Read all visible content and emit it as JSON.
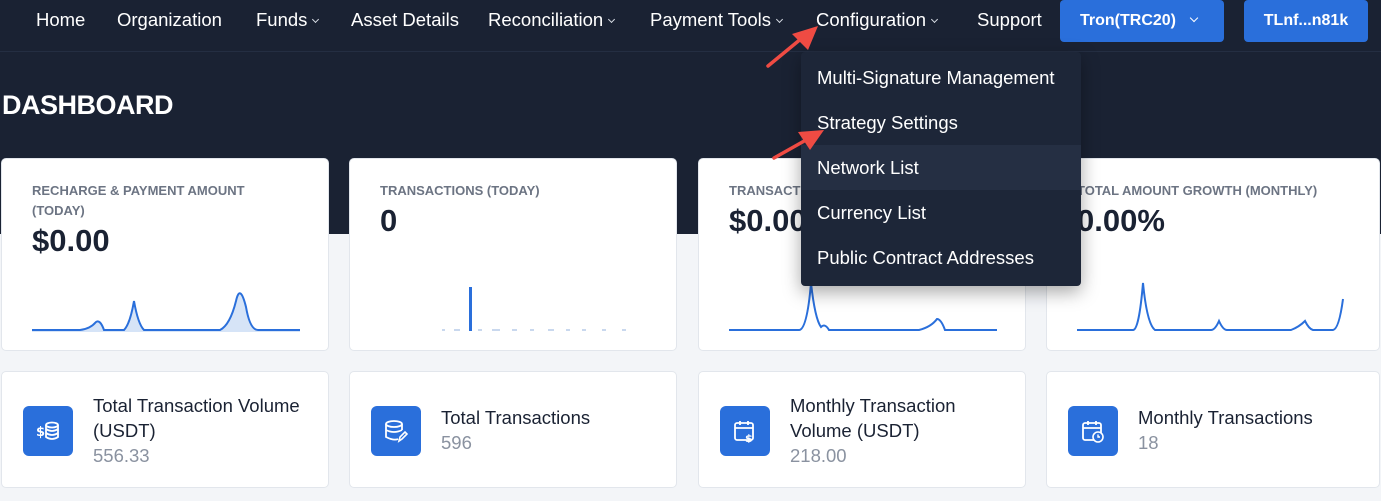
{
  "nav": {
    "items": [
      {
        "label": "Home",
        "has_menu": false
      },
      {
        "label": "Organization",
        "has_menu": false
      },
      {
        "label": "Funds",
        "has_menu": true
      },
      {
        "label": "Asset Details",
        "has_menu": false
      },
      {
        "label": "Reconciliation",
        "has_menu": true
      },
      {
        "label": "Payment Tools",
        "has_menu": true
      },
      {
        "label": "Configuration",
        "has_menu": true
      },
      {
        "label": "Support",
        "has_menu": false
      }
    ],
    "network_button": "Tron(TRC20)",
    "wallet_button": "TLnf...n81k"
  },
  "page_title": "DASHBOARD",
  "kpi_cards": [
    {
      "label": "RECHARGE & PAYMENT AMOUNT (TODAY)",
      "value": "$0.00"
    },
    {
      "label": "TRANSACTIONS (TODAY)",
      "value": "0"
    },
    {
      "label": "TRANSACTI",
      "value": "$0.00"
    },
    {
      "label": "TOTAL AMOUNT GROWTH (MONTHLY)",
      "value": "0.00%"
    }
  ],
  "stat_cards": [
    {
      "title": "Total Transaction Volume (USDT)",
      "value": "556.33",
      "icon": "dollar-coins-icon"
    },
    {
      "title": "Total Transactions",
      "value": "596",
      "icon": "database-edit-icon"
    },
    {
      "title": "Monthly Transaction Volume (USDT)",
      "value": "218.00",
      "icon": "calendar-dollar-icon"
    },
    {
      "title": "Monthly Transactions",
      "value": "18",
      "icon": "calendar-clock-icon"
    }
  ],
  "configuration_menu": {
    "items": [
      "Multi-Signature Management",
      "Strategy Settings",
      "Network List",
      "Currency List",
      "Public Contract Addresses"
    ],
    "hovered_item": "Network List"
  },
  "colors": {
    "header_bg": "#1a2233",
    "accent": "#2a6fdb",
    "dropdown_bg": "#1d2638",
    "annotation_arrow": "#ef4b43",
    "sparkline": "#2a6fdb"
  }
}
